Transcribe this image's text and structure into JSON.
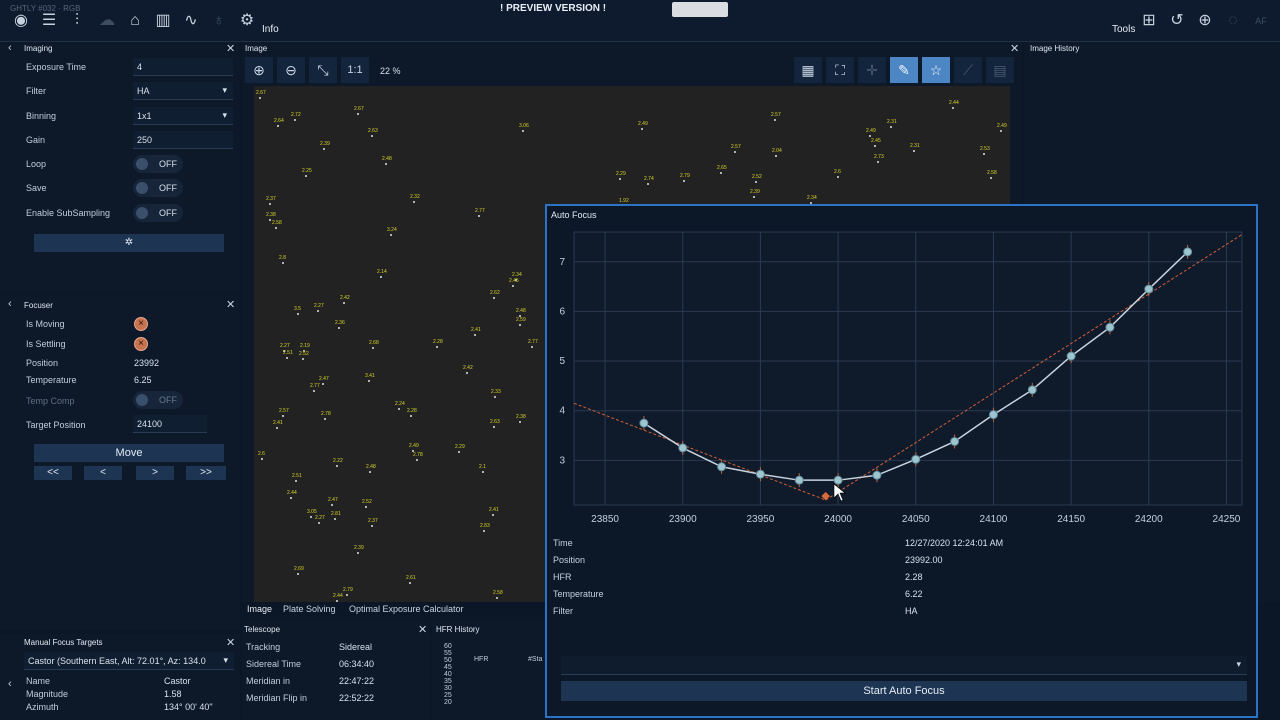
{
  "topbar": {
    "title_fragment": "GHTLY #032 · RGB",
    "preview": "! PREVIEW VERSION !",
    "info_label": "Info",
    "tools_label": "Tools"
  },
  "imaging": {
    "title": "Imaging",
    "rows": [
      {
        "label": "Exposure Time",
        "value": "4"
      },
      {
        "label": "Filter",
        "value": "HA"
      },
      {
        "label": "Binning",
        "value": "1x1"
      },
      {
        "label": "Gain",
        "value": "250"
      }
    ],
    "toggles": [
      {
        "label": "Loop",
        "value": "OFF"
      },
      {
        "label": "Save",
        "value": "OFF"
      },
      {
        "label": "Enable SubSampling",
        "value": "OFF"
      }
    ]
  },
  "focuser": {
    "title": "Focuser",
    "is_moving": "Is Moving",
    "is_settling": "Is Settling",
    "position_label": "Position",
    "position_value": "23992",
    "temperature_label": "Temperature",
    "temperature_value": "6.25",
    "temp_comp_label": "Temp Comp",
    "temp_comp_value": "OFF",
    "target_label": "Target Position",
    "target_value": "24100",
    "move": "Move",
    "steps": [
      "<<",
      "<",
      ">",
      ">>"
    ]
  },
  "manual_focus": {
    "title": "Manual Focus Targets",
    "selected": "Castor (Southern East, Alt: 72.01°, Az: 134.0",
    "rows": [
      {
        "label": "Name",
        "value": "Castor"
      },
      {
        "label": "Magnitude",
        "value": "1.58"
      },
      {
        "label": "Azimuth",
        "value": "134° 00' 40\""
      }
    ]
  },
  "image_panel": {
    "title": "Image",
    "zoom_fit": "1:1",
    "zoom_pct": "22 %",
    "tabs": [
      "Image",
      "Plate Solving",
      "Optimal Exposure Calculator"
    ]
  },
  "image_history": {
    "title": "Image History"
  },
  "telescope": {
    "title": "Telescope",
    "rows": [
      {
        "label": "Tracking",
        "value": "Sidereal"
      },
      {
        "label": "Sidereal Time",
        "value": "06:34:40"
      },
      {
        "label": "Meridian in",
        "value": "22:47:22"
      },
      {
        "label": "Meridian Flip in",
        "value": "22:52:22"
      }
    ]
  },
  "hfr_history": {
    "title": "HFR History",
    "legend": [
      "HFR",
      "#Sta"
    ],
    "y_ticks": [
      "60",
      "55",
      "50",
      "45",
      "40",
      "35",
      "30",
      "25",
      "20"
    ]
  },
  "autofocus": {
    "title": "Auto Focus",
    "info": [
      {
        "label": "Time",
        "value": "12/27/2020 12:24:01 AM"
      },
      {
        "label": "Position",
        "value": "23992.00"
      },
      {
        "label": "HFR",
        "value": "2.28"
      },
      {
        "label": "Temperature",
        "value": "6.22"
      },
      {
        "label": "Filter",
        "value": "HA"
      }
    ],
    "start_button": "Start Auto Focus"
  },
  "chart_data": {
    "type": "scatter",
    "xlabel": "",
    "ylabel": "",
    "xlim": [
      23830,
      24260
    ],
    "ylim": [
      2.1,
      7.6
    ],
    "x_ticks": [
      23850,
      23900,
      23950,
      24000,
      24050,
      24100,
      24150,
      24200,
      24250
    ],
    "y_ticks": [
      3,
      4,
      5,
      6,
      7
    ],
    "grid": true,
    "series": [
      {
        "points": [
          {
            "x": 23875,
            "y": 3.75
          },
          {
            "x": 23900,
            "y": 3.25
          },
          {
            "x": 23925,
            "y": 2.87
          },
          {
            "x": 23950,
            "y": 2.72
          },
          {
            "x": 23975,
            "y": 2.6
          },
          {
            "x": 24000,
            "y": 2.6
          },
          {
            "x": 24025,
            "y": 2.7
          },
          {
            "x": 24050,
            "y": 3.02
          },
          {
            "x": 24075,
            "y": 3.38
          },
          {
            "x": 24100,
            "y": 3.92
          },
          {
            "x": 24125,
            "y": 4.42
          },
          {
            "x": 24150,
            "y": 5.1
          },
          {
            "x": 24175,
            "y": 5.68
          },
          {
            "x": 24200,
            "y": 6.45
          },
          {
            "x": 24225,
            "y": 7.2
          }
        ]
      }
    ],
    "fit_lines": [
      {
        "x": [
          23830,
          23992
        ],
        "y": [
          4.15,
          2.2
        ]
      },
      {
        "x": [
          23992,
          24260
        ],
        "y": [
          2.2,
          7.55
        ]
      }
    ],
    "minimum": {
      "x": 23992,
      "y": 2.28
    }
  },
  "hfr_labels": [
    {
      "t": "2.67",
      "x": 2,
      "y": 4
    },
    {
      "t": "2.72",
      "x": 37,
      "y": 26
    },
    {
      "t": "2.64",
      "x": 20,
      "y": 32
    },
    {
      "t": "2.67",
      "x": 100,
      "y": 20
    },
    {
      "t": "2.63",
      "x": 114,
      "y": 42
    },
    {
      "t": "2.39",
      "x": 66,
      "y": 55
    },
    {
      "t": "2.48",
      "x": 128,
      "y": 70
    },
    {
      "t": "2.25",
      "x": 48,
      "y": 82
    },
    {
      "t": "3.06",
      "x": 265,
      "y": 37
    },
    {
      "t": "2.49",
      "x": 384,
      "y": 35
    },
    {
      "t": "2.57",
      "x": 517,
      "y": 26
    },
    {
      "t": "2.44",
      "x": 695,
      "y": 14
    },
    {
      "t": "2.31",
      "x": 633,
      "y": 33
    },
    {
      "t": "2.49",
      "x": 612,
      "y": 42
    },
    {
      "t": "2.45",
      "x": 617,
      "y": 52
    },
    {
      "t": "2.49",
      "x": 743,
      "y": 37
    },
    {
      "t": "2.57",
      "x": 477,
      "y": 58
    },
    {
      "t": "2.04",
      "x": 518,
      "y": 62
    },
    {
      "t": "2.31",
      "x": 656,
      "y": 57
    },
    {
      "t": "2.53",
      "x": 726,
      "y": 60
    },
    {
      "t": "2.73",
      "x": 620,
      "y": 68
    },
    {
      "t": "2.29",
      "x": 362,
      "y": 85
    },
    {
      "t": "2.74",
      "x": 390,
      "y": 90
    },
    {
      "t": "2.79",
      "x": 426,
      "y": 87
    },
    {
      "t": "2.65",
      "x": 463,
      "y": 79
    },
    {
      "t": "2.52",
      "x": 498,
      "y": 88
    },
    {
      "t": "2.6",
      "x": 580,
      "y": 83
    },
    {
      "t": "2.58",
      "x": 733,
      "y": 84
    },
    {
      "t": "2.37",
      "x": 12,
      "y": 110
    },
    {
      "t": "2.32",
      "x": 156,
      "y": 108
    },
    {
      "t": "2.77",
      "x": 221,
      "y": 122
    },
    {
      "t": "2.39",
      "x": 496,
      "y": 103
    },
    {
      "t": "2.34",
      "x": 553,
      "y": 109
    },
    {
      "t": "1.92",
      "x": 365,
      "y": 112
    },
    {
      "t": "2.38",
      "x": 12,
      "y": 126
    },
    {
      "t": "2.58",
      "x": 18,
      "y": 134
    },
    {
      "t": "3.24",
      "x": 133,
      "y": 141
    },
    {
      "t": "2.8",
      "x": 25,
      "y": 169
    },
    {
      "t": "2.14",
      "x": 123,
      "y": 183
    },
    {
      "t": "2.34",
      "x": 258,
      "y": 186
    },
    {
      "t": "2.45",
      "x": 255,
      "y": 192
    },
    {
      "t": "2.62",
      "x": 236,
      "y": 204
    },
    {
      "t": "2.42",
      "x": 86,
      "y": 209
    },
    {
      "t": "3.5",
      "x": 40,
      "y": 220
    },
    {
      "t": "2.27",
      "x": 60,
      "y": 217
    },
    {
      "t": "2.48",
      "x": 262,
      "y": 222
    },
    {
      "t": "2.59",
      "x": 262,
      "y": 231
    },
    {
      "t": "2.36",
      "x": 81,
      "y": 234
    },
    {
      "t": "2.41",
      "x": 217,
      "y": 241
    },
    {
      "t": "2.77",
      "x": 274,
      "y": 253
    },
    {
      "t": "2.27",
      "x": 26,
      "y": 257
    },
    {
      "t": "2.19",
      "x": 46,
      "y": 257
    },
    {
      "t": "2.51",
      "x": 29,
      "y": 264
    },
    {
      "t": "2.52",
      "x": 45,
      "y": 265
    },
    {
      "t": "2.68",
      "x": 115,
      "y": 254
    },
    {
      "t": "2.28",
      "x": 179,
      "y": 253
    },
    {
      "t": "2.77",
      "x": 56,
      "y": 297
    },
    {
      "t": "2.47",
      "x": 65,
      "y": 290
    },
    {
      "t": "3.41",
      "x": 111,
      "y": 287
    },
    {
      "t": "2.42",
      "x": 209,
      "y": 279
    },
    {
      "t": "2.33",
      "x": 237,
      "y": 303
    },
    {
      "t": "2.57",
      "x": 25,
      "y": 322
    },
    {
      "t": "2.41",
      "x": 19,
      "y": 334
    },
    {
      "t": "2.78",
      "x": 67,
      "y": 325
    },
    {
      "t": "2.24",
      "x": 141,
      "y": 315
    },
    {
      "t": "2.28",
      "x": 153,
      "y": 322
    },
    {
      "t": "2.38",
      "x": 262,
      "y": 328
    },
    {
      "t": "2.63",
      "x": 236,
      "y": 333
    },
    {
      "t": "2.49",
      "x": 155,
      "y": 357
    },
    {
      "t": "2.78",
      "x": 159,
      "y": 366
    },
    {
      "t": "2.29",
      "x": 201,
      "y": 358
    },
    {
      "t": "2.6",
      "x": 4,
      "y": 365
    },
    {
      "t": "2.22",
      "x": 79,
      "y": 372
    },
    {
      "t": "2.48",
      "x": 112,
      "y": 378
    },
    {
      "t": "2.1",
      "x": 225,
      "y": 378
    },
    {
      "t": "2.51",
      "x": 38,
      "y": 387
    },
    {
      "t": "2.44",
      "x": 33,
      "y": 404
    },
    {
      "t": "2.47",
      "x": 74,
      "y": 411
    },
    {
      "t": "2.52",
      "x": 108,
      "y": 413
    },
    {
      "t": "3.05",
      "x": 53,
      "y": 423
    },
    {
      "t": "2.27",
      "x": 61,
      "y": 429
    },
    {
      "t": "2.81",
      "x": 77,
      "y": 425
    },
    {
      "t": "2.37",
      "x": 114,
      "y": 432
    },
    {
      "t": "2.41",
      "x": 235,
      "y": 421
    },
    {
      "t": "2.83",
      "x": 226,
      "y": 437
    },
    {
      "t": "2.39",
      "x": 100,
      "y": 459
    },
    {
      "t": "2.69",
      "x": 40,
      "y": 480
    },
    {
      "t": "2.61",
      "x": 152,
      "y": 489
    },
    {
      "t": "2.79",
      "x": 89,
      "y": 501
    },
    {
      "t": "2.44",
      "x": 79,
      "y": 507
    },
    {
      "t": "2.58",
      "x": 239,
      "y": 504
    }
  ]
}
